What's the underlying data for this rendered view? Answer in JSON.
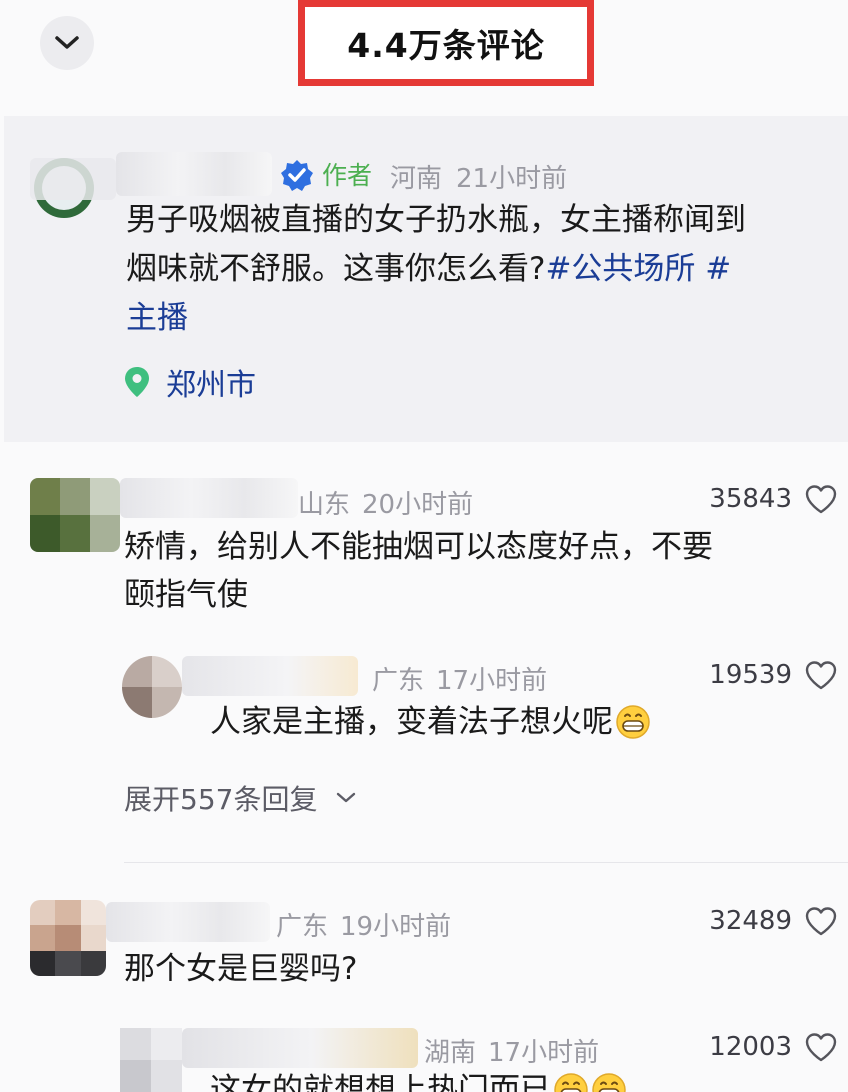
{
  "header": {
    "title": "4.4万条评论"
  },
  "post": {
    "author_badge": "作者",
    "location": "河南",
    "time": "21小时前",
    "text_line1": "男子吸烟被直播的女子扔水瓶，女主播称闻到",
    "text_line2_plain": "烟味就不舒服。这事你怎么看?",
    "tag1": "#公共场所",
    "tag2_start": "#",
    "tag2_end": "主播",
    "place": "郑州市"
  },
  "comments": [
    {
      "location": "山东",
      "time": "20小时前",
      "likes": "35843",
      "text_line1": "矫情，给别人不能抽烟可以态度好点，不要",
      "text_line2": "颐指气使",
      "reply": {
        "location": "广东",
        "time": "17小时前",
        "likes": "19539",
        "text": "人家是主播，变着法子想火呢"
      },
      "expand_label": "展开557条回复"
    },
    {
      "location": "广东",
      "time": "19小时前",
      "likes": "32489",
      "text_line1": "那个女是巨婴吗?",
      "reply": {
        "location": "湖南",
        "time": "17小时前",
        "likes": "12003",
        "text": "这女的就想想上热门而已"
      }
    }
  ],
  "icons": {
    "collapse": "chevron-down-icon",
    "verified": "verified-badge-icon",
    "location": "location-pin-icon",
    "like": "heart-outline-icon",
    "emoji": "grinning-emoji-icon"
  },
  "colors": {
    "highlight_border": "#e53935",
    "link_blue": "#1b3d96",
    "author_green": "#4caf50",
    "verified_blue": "#2f6fe0"
  }
}
